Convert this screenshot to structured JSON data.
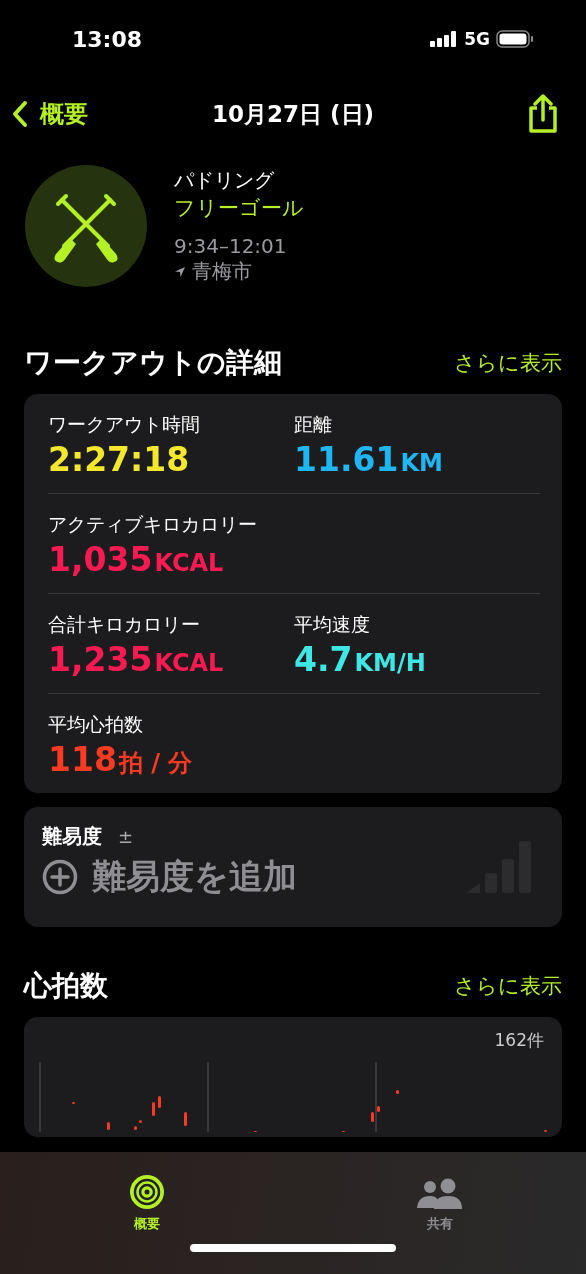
{
  "status_bar": {
    "time": "13:08",
    "network": "5G"
  },
  "nav": {
    "back_label": "概要",
    "title": "10月27日 (日)"
  },
  "workout": {
    "name": "パドリング",
    "goal": "フリーゴール",
    "time_range": "9:34–12:01",
    "location": "青梅市"
  },
  "details": {
    "title": "ワークアウトの詳細",
    "more": "さらに表示",
    "rows": [
      {
        "metrics": [
          {
            "label": "ワークアウト時間",
            "value": "2:27:18",
            "color": "#f5e82c"
          },
          {
            "label": "距離",
            "value": "11.61",
            "unit": "KM",
            "color": "#1fb6f5"
          }
        ]
      },
      {
        "metrics": [
          {
            "label": "アクティブキロカロリー",
            "value": "1,035",
            "unit": "KCAL",
            "color": "#fa1a52"
          }
        ]
      },
      {
        "metrics": [
          {
            "label": "合計キロカロリー",
            "value": "1,235",
            "unit": "KCAL",
            "color": "#fa1a52"
          },
          {
            "label": "平均速度",
            "value": "4.7",
            "unit": "KM/H",
            "color": "#3ee6e6"
          }
        ]
      },
      {
        "metrics": [
          {
            "label": "平均心拍数",
            "value": "118",
            "unit": "拍 / 分",
            "color": "#fb3a22"
          }
        ]
      }
    ]
  },
  "difficulty": {
    "label": "難易度",
    "symbol": "±",
    "add_label": "難易度を追加"
  },
  "heart_rate": {
    "title": "心拍数",
    "more": "さらに表示",
    "count": "162件"
  },
  "tabs": [
    {
      "label": "概要",
      "selected": true,
      "kind": "summary"
    },
    {
      "label": "共有",
      "selected": false,
      "kind": "sharing"
    }
  ]
}
